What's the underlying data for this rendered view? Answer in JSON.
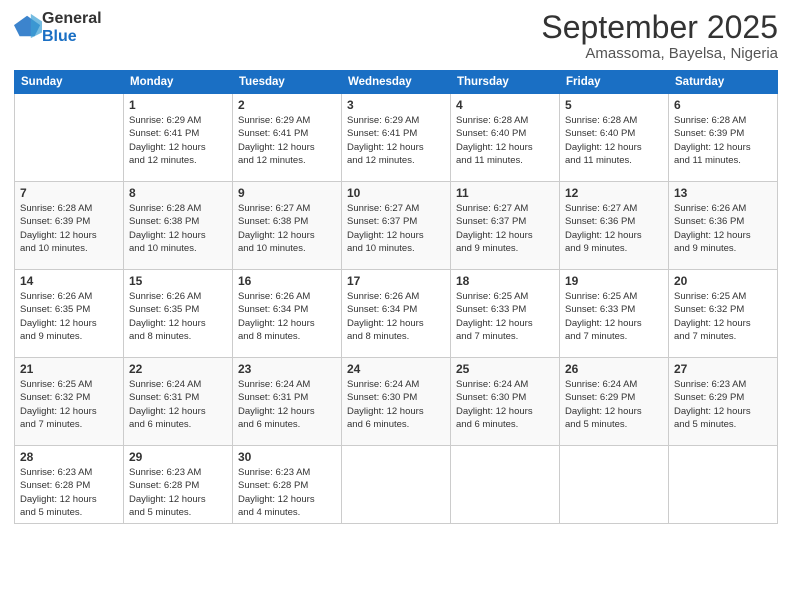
{
  "logo": {
    "general": "General",
    "blue": "Blue"
  },
  "title": "September 2025",
  "location": "Amassoma, Bayelsa, Nigeria",
  "headers": [
    "Sunday",
    "Monday",
    "Tuesday",
    "Wednesday",
    "Thursday",
    "Friday",
    "Saturday"
  ],
  "weeks": [
    [
      {
        "day": "",
        "info": ""
      },
      {
        "day": "1",
        "info": "Sunrise: 6:29 AM\nSunset: 6:41 PM\nDaylight: 12 hours\nand 12 minutes."
      },
      {
        "day": "2",
        "info": "Sunrise: 6:29 AM\nSunset: 6:41 PM\nDaylight: 12 hours\nand 12 minutes."
      },
      {
        "day": "3",
        "info": "Sunrise: 6:29 AM\nSunset: 6:41 PM\nDaylight: 12 hours\nand 12 minutes."
      },
      {
        "day": "4",
        "info": "Sunrise: 6:28 AM\nSunset: 6:40 PM\nDaylight: 12 hours\nand 11 minutes."
      },
      {
        "day": "5",
        "info": "Sunrise: 6:28 AM\nSunset: 6:40 PM\nDaylight: 12 hours\nand 11 minutes."
      },
      {
        "day": "6",
        "info": "Sunrise: 6:28 AM\nSunset: 6:39 PM\nDaylight: 12 hours\nand 11 minutes."
      }
    ],
    [
      {
        "day": "7",
        "info": "Sunrise: 6:28 AM\nSunset: 6:39 PM\nDaylight: 12 hours\nand 10 minutes."
      },
      {
        "day": "8",
        "info": "Sunrise: 6:28 AM\nSunset: 6:38 PM\nDaylight: 12 hours\nand 10 minutes."
      },
      {
        "day": "9",
        "info": "Sunrise: 6:27 AM\nSunset: 6:38 PM\nDaylight: 12 hours\nand 10 minutes."
      },
      {
        "day": "10",
        "info": "Sunrise: 6:27 AM\nSunset: 6:37 PM\nDaylight: 12 hours\nand 10 minutes."
      },
      {
        "day": "11",
        "info": "Sunrise: 6:27 AM\nSunset: 6:37 PM\nDaylight: 12 hours\nand 9 minutes."
      },
      {
        "day": "12",
        "info": "Sunrise: 6:27 AM\nSunset: 6:36 PM\nDaylight: 12 hours\nand 9 minutes."
      },
      {
        "day": "13",
        "info": "Sunrise: 6:26 AM\nSunset: 6:36 PM\nDaylight: 12 hours\nand 9 minutes."
      }
    ],
    [
      {
        "day": "14",
        "info": "Sunrise: 6:26 AM\nSunset: 6:35 PM\nDaylight: 12 hours\nand 9 minutes."
      },
      {
        "day": "15",
        "info": "Sunrise: 6:26 AM\nSunset: 6:35 PM\nDaylight: 12 hours\nand 8 minutes."
      },
      {
        "day": "16",
        "info": "Sunrise: 6:26 AM\nSunset: 6:34 PM\nDaylight: 12 hours\nand 8 minutes."
      },
      {
        "day": "17",
        "info": "Sunrise: 6:26 AM\nSunset: 6:34 PM\nDaylight: 12 hours\nand 8 minutes."
      },
      {
        "day": "18",
        "info": "Sunrise: 6:25 AM\nSunset: 6:33 PM\nDaylight: 12 hours\nand 7 minutes."
      },
      {
        "day": "19",
        "info": "Sunrise: 6:25 AM\nSunset: 6:33 PM\nDaylight: 12 hours\nand 7 minutes."
      },
      {
        "day": "20",
        "info": "Sunrise: 6:25 AM\nSunset: 6:32 PM\nDaylight: 12 hours\nand 7 minutes."
      }
    ],
    [
      {
        "day": "21",
        "info": "Sunrise: 6:25 AM\nSunset: 6:32 PM\nDaylight: 12 hours\nand 7 minutes."
      },
      {
        "day": "22",
        "info": "Sunrise: 6:24 AM\nSunset: 6:31 PM\nDaylight: 12 hours\nand 6 minutes."
      },
      {
        "day": "23",
        "info": "Sunrise: 6:24 AM\nSunset: 6:31 PM\nDaylight: 12 hours\nand 6 minutes."
      },
      {
        "day": "24",
        "info": "Sunrise: 6:24 AM\nSunset: 6:30 PM\nDaylight: 12 hours\nand 6 minutes."
      },
      {
        "day": "25",
        "info": "Sunrise: 6:24 AM\nSunset: 6:30 PM\nDaylight: 12 hours\nand 6 minutes."
      },
      {
        "day": "26",
        "info": "Sunrise: 6:24 AM\nSunset: 6:29 PM\nDaylight: 12 hours\nand 5 minutes."
      },
      {
        "day": "27",
        "info": "Sunrise: 6:23 AM\nSunset: 6:29 PM\nDaylight: 12 hours\nand 5 minutes."
      }
    ],
    [
      {
        "day": "28",
        "info": "Sunrise: 6:23 AM\nSunset: 6:28 PM\nDaylight: 12 hours\nand 5 minutes."
      },
      {
        "day": "29",
        "info": "Sunrise: 6:23 AM\nSunset: 6:28 PM\nDaylight: 12 hours\nand 5 minutes."
      },
      {
        "day": "30",
        "info": "Sunrise: 6:23 AM\nSunset: 6:28 PM\nDaylight: 12 hours\nand 4 minutes."
      },
      {
        "day": "",
        "info": ""
      },
      {
        "day": "",
        "info": ""
      },
      {
        "day": "",
        "info": ""
      },
      {
        "day": "",
        "info": ""
      }
    ]
  ]
}
